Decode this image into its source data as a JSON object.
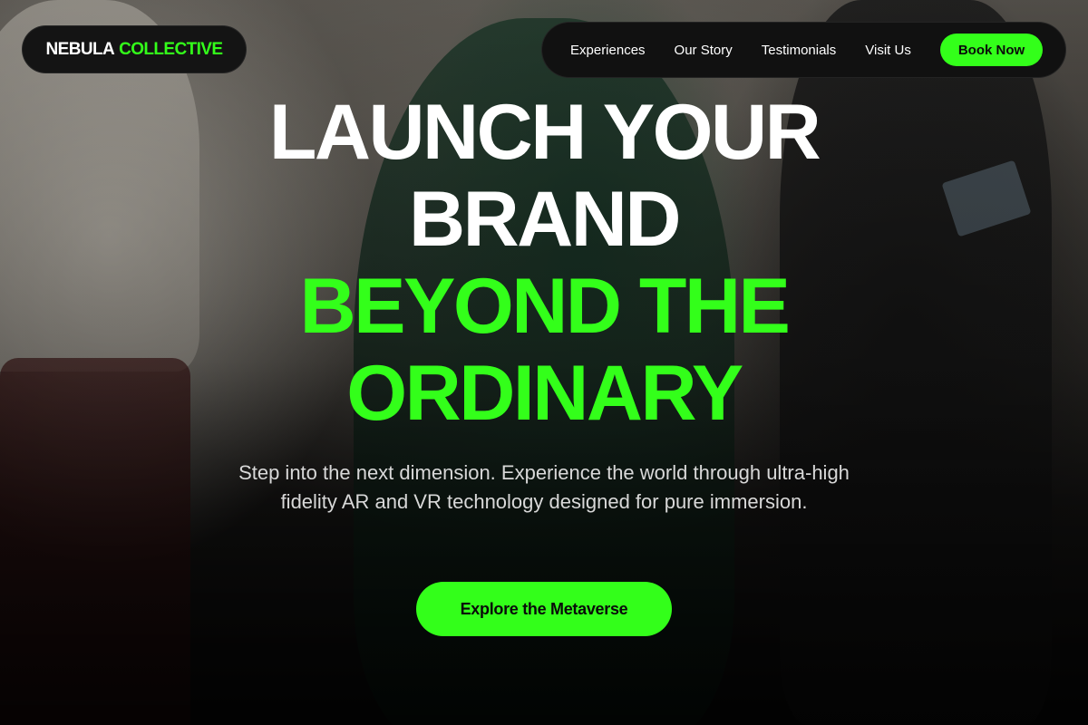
{
  "brand": {
    "name_primary": "NEBULA",
    "name_accent": "COLLECTIVE",
    "accent_color": "#33ff1a"
  },
  "nav": {
    "links": [
      {
        "label": "Experiences"
      },
      {
        "label": "Our Story"
      },
      {
        "label": "Testimonials"
      },
      {
        "label": "Visit Us"
      }
    ],
    "book_label": "Book Now"
  },
  "hero": {
    "headline_lines": [
      {
        "text": "LAUNCH YOUR",
        "color": "#ffffff"
      },
      {
        "text": "BRAND",
        "color": "#ffffff"
      },
      {
        "text": "BEYOND THE",
        "color": "#33ff1a"
      },
      {
        "text": "ORDINARY",
        "color": "#33ff1a"
      }
    ],
    "subtext": "Step into the next dimension. Experience the world through ultra-high fidelity AR and VR technology designed for pure immersion.",
    "cta_label": "Explore the Metaverse"
  }
}
